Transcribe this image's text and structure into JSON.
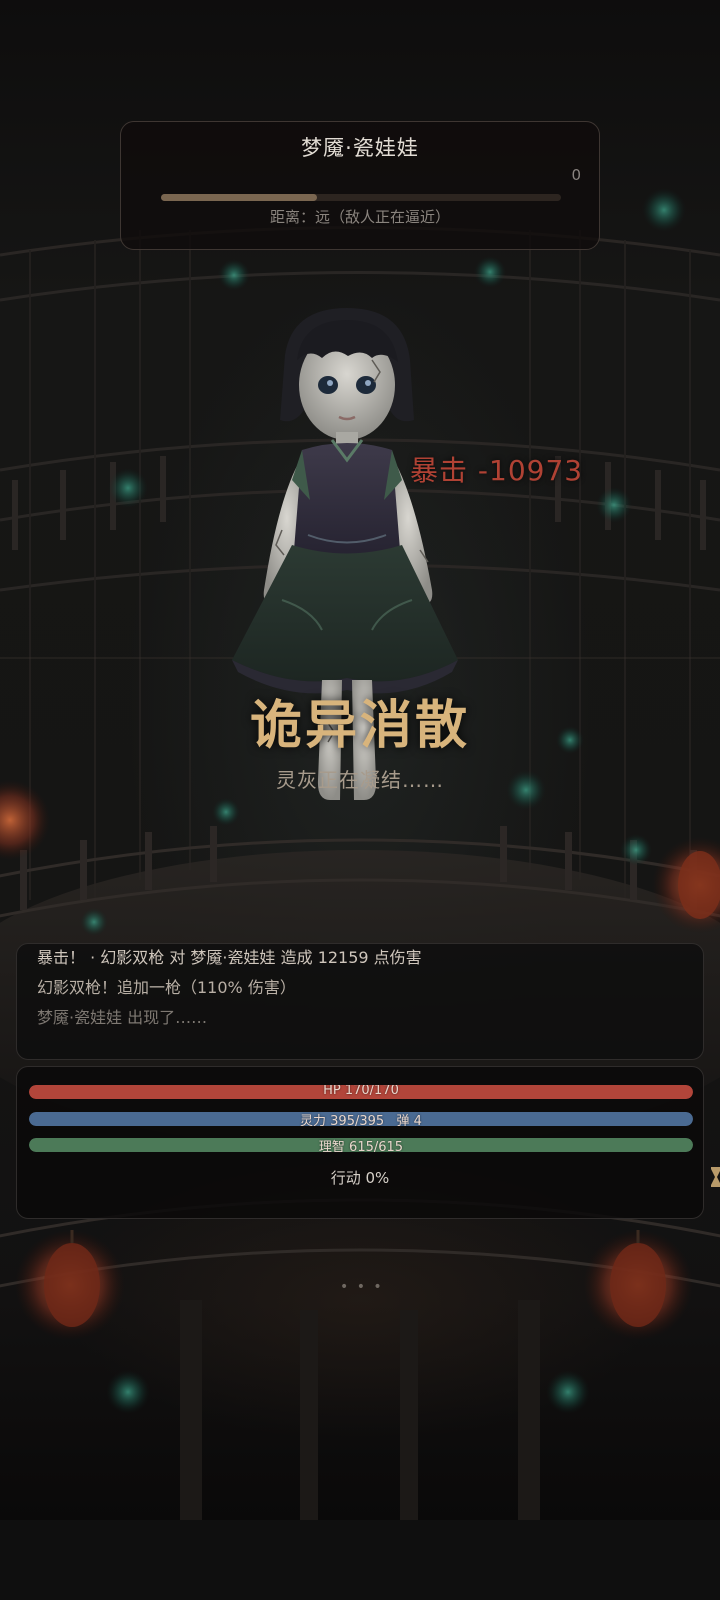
{
  "enemy": {
    "name": "梦魇·瓷娃娃",
    "value": "0",
    "progress_fraction": 0.39,
    "distance": "距离：远（敌人正在逼近）",
    "bar_color": "#7a6650"
  },
  "combat": {
    "crit_popup": "暴击 -10973",
    "banner_title": "诡异消散",
    "banner_subtitle": "灵灰正在凝结……"
  },
  "log": {
    "lines": [
      {
        "text": "暴击！ · 幻影双枪 对 梦魇·瓷娃娃 造成 12159 点伤害",
        "color": "#cfc6bc"
      },
      {
        "text": "幻影双枪！追加一枪（110% 伤害）",
        "color": "#b8afa5"
      },
      {
        "text": "梦魇·瓷娃娃 出现了……",
        "color": "#7e7872"
      }
    ]
  },
  "stats": {
    "hp": {
      "label": "HP 170/170",
      "fraction": 1.0,
      "color": "#b2453a"
    },
    "mana": {
      "label": "灵力 395/395   弹 4",
      "fraction": 1.0,
      "color": "#4a6a92"
    },
    "sanity": {
      "label": "理智 615/615",
      "fraction": 1.0,
      "color": "#4c7a58"
    },
    "action": {
      "label": "行动 0%",
      "fraction": 0.0
    }
  },
  "footer": {
    "more_dots": "• • •"
  },
  "icons": {
    "hourglass": "hourglass-icon"
  }
}
